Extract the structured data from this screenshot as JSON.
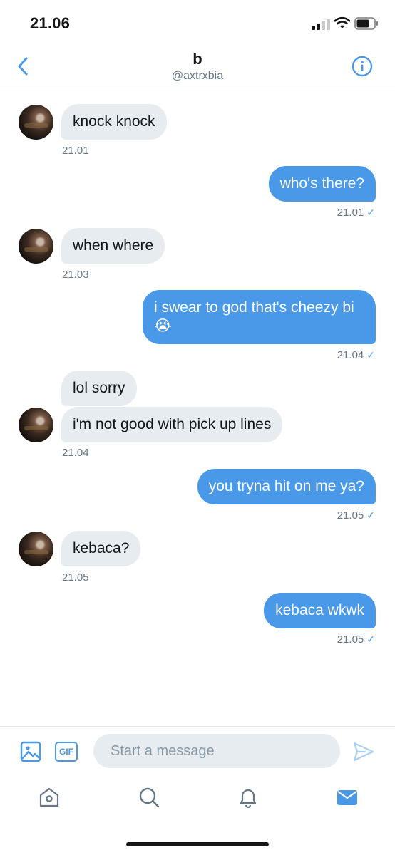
{
  "status_bar": {
    "time": "21.06"
  },
  "header": {
    "name": "b",
    "handle": "@axtrxbia"
  },
  "messages": [
    {
      "text": "knock knock",
      "time": "21.01"
    },
    {
      "text": "who's there?",
      "time": "21.01",
      "check": "✓"
    },
    {
      "text": "when where",
      "time": "21.03"
    },
    {
      "text": "i swear to god that's cheezy bi 😭",
      "time": "21.04",
      "check": "✓"
    },
    {
      "text": "lol sorry"
    },
    {
      "text": "i'm not good with pick up lines",
      "time": "21.04"
    },
    {
      "text": "you tryna hit on me ya?",
      "time": "21.05",
      "check": "✓"
    },
    {
      "text": "kebaca?",
      "time": "21.05"
    },
    {
      "text": "kebaca wkwk",
      "time": "21.05",
      "check": "✓"
    }
  ],
  "composer": {
    "gif_label": "GIF",
    "placeholder": "Start a message",
    "value": ""
  },
  "icons": {
    "back": "chevron-left-icon",
    "info": "info-icon",
    "image": "image-icon",
    "send": "send-icon",
    "home": "home-icon",
    "search": "search-icon",
    "notifications": "bell-icon",
    "messages": "mail-icon"
  },
  "colors": {
    "accent": "#4a99e9",
    "incoming_bubble": "#e6ecf0",
    "secondary_text": "#657786"
  }
}
